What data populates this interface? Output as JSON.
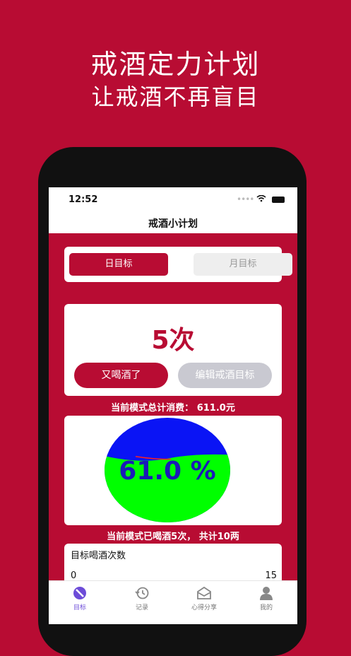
{
  "promo": {
    "line1": "戒酒定力计划",
    "line2": "让戒酒不再盲目"
  },
  "status_bar": {
    "time": "12:52"
  },
  "nav": {
    "title": "戒酒小计划"
  },
  "tabs": [
    {
      "label": "日目标",
      "active": true
    },
    {
      "label": "月目标",
      "active": false
    }
  ],
  "counter": {
    "value": "5次",
    "drink_button": "又喝酒了",
    "edit_button": "编辑戒酒目标"
  },
  "summary": {
    "total_spent_line": "当前模式总计消费： 611.0元",
    "drunk_line": "当前模式已喝酒5次， 共计10两"
  },
  "chart_data": {
    "type": "gauge",
    "percent_label": "61.0 %",
    "fill_fraction": 0.61,
    "fill_color": "#00ff00",
    "empty_color": "#0a14f5",
    "label_color": "#1a1ab8"
  },
  "target": {
    "title": "目标喝酒次数",
    "min": "0",
    "max": "15"
  },
  "tabbar": [
    {
      "label": "目标",
      "icon": "target-icon",
      "active": true
    },
    {
      "label": "记录",
      "icon": "history-icon",
      "active": false
    },
    {
      "label": "心得分享",
      "icon": "share-icon",
      "active": false
    },
    {
      "label": "我的",
      "icon": "profile-icon",
      "active": false
    }
  ],
  "colors": {
    "brand": "#b80c33",
    "accent": "#6d4cd8"
  }
}
